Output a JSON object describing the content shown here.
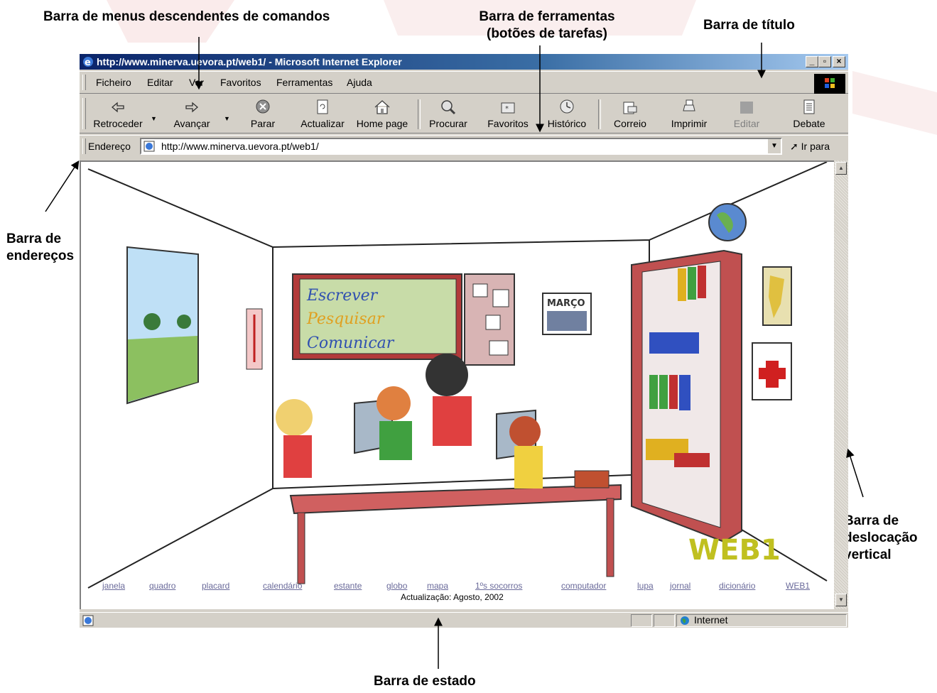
{
  "callouts": {
    "menus": "Barra de menus descendentes  de comandos",
    "toolbar_line1": "Barra de ferramentas",
    "toolbar_line2": "(botões de tarefas)",
    "title": "Barra de título",
    "address_line1": "Barra de",
    "address_line2": "endereços",
    "scroll_line1": "Barra de",
    "scroll_line2": "deslocação",
    "scroll_line3": "vertical",
    "status": "Barra de estado"
  },
  "window": {
    "title": "http://www.minerva.uevora.pt/web1/ - Microsoft Internet Explorer",
    "controls": {
      "minimize": "_",
      "maximize": "▫",
      "close": "×"
    }
  },
  "menu": {
    "items": [
      "Ficheiro",
      "Editar",
      "Ver",
      "Favoritos",
      "Ferramentas",
      "Ajuda"
    ]
  },
  "toolbar": {
    "buttons": [
      {
        "label": "Retroceder",
        "icon": "back-arrow-icon"
      },
      {
        "label": "Avançar",
        "icon": "forward-arrow-icon"
      },
      {
        "label": "Parar",
        "icon": "stop-icon"
      },
      {
        "label": "Actualizar",
        "icon": "refresh-icon"
      },
      {
        "label": "Home page",
        "icon": "home-icon"
      },
      {
        "label": "Procurar",
        "icon": "search-icon"
      },
      {
        "label": "Favoritos",
        "icon": "favorites-icon"
      },
      {
        "label": "Histórico",
        "icon": "history-icon"
      },
      {
        "label": "Correio",
        "icon": "mail-icon"
      },
      {
        "label": "Imprimir",
        "icon": "print-icon"
      },
      {
        "label": "Editar",
        "icon": "edit-icon",
        "disabled": true
      },
      {
        "label": "Debate",
        "icon": "discuss-icon"
      }
    ]
  },
  "address": {
    "label": "Endereço",
    "url": "http://www.minerva.uevora.pt/web1/",
    "go": "Ir para"
  },
  "page": {
    "links": [
      "janela",
      "quadro",
      "placard",
      "calendário",
      "estante",
      "globo",
      "mapa",
      "1ºs socorros",
      "computador",
      "lupa",
      "jornal",
      "dicionário",
      "WEB1"
    ],
    "updated": "Actualização: Agosto, 2002",
    "board": [
      "Escrever",
      "Pesquisar",
      "Comunicar"
    ],
    "calendar": "MARÇO",
    "logo": "WEB1"
  },
  "status": {
    "zone": "Internet"
  },
  "colors": {
    "title_start": "#0a246a",
    "title_end": "#a6caf0",
    "chrome": "#d4d0c8",
    "link": "#6a6a9a"
  }
}
